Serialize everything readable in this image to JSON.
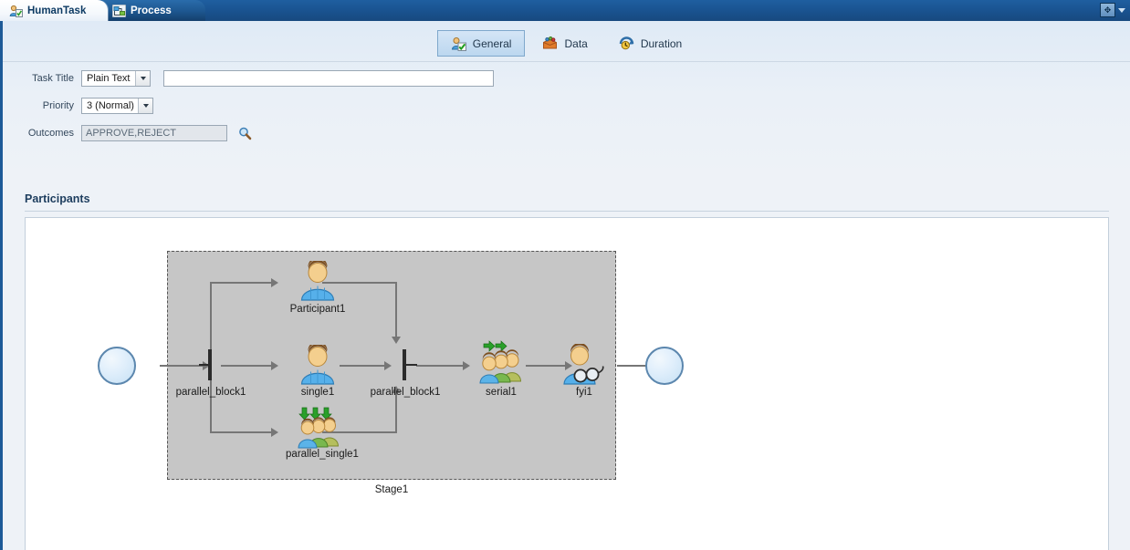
{
  "window": {
    "tabs": [
      {
        "label": "HumanTask",
        "icon": "human-task-icon",
        "active": true
      },
      {
        "label": "Process",
        "icon": "process-diagram-icon",
        "active": false
      }
    ],
    "buttons": {
      "restore_label": "✥",
      "menu_label": "▾"
    }
  },
  "subtabs": [
    {
      "label": "General",
      "icon": "general-icon",
      "selected": true
    },
    {
      "label": "Data",
      "icon": "data-icon",
      "selected": false
    },
    {
      "label": "Duration",
      "icon": "duration-icon",
      "selected": false
    }
  ],
  "form": {
    "task_title": {
      "label": "Task Title",
      "type_value": "Plain Text",
      "value": "",
      "placeholder": ""
    },
    "priority": {
      "label": "Priority",
      "value": "3 (Normal)"
    },
    "outcomes": {
      "label": "Outcomes",
      "value": "APPROVE,REJECT",
      "browse_icon": "magnifier-icon"
    }
  },
  "participants": {
    "section_title": "Participants",
    "stage_label": "Stage1",
    "nodes": [
      {
        "id": "start",
        "label": "",
        "icon": "start-event-icon"
      },
      {
        "id": "parallel_block_fork",
        "label": "parallel_block1",
        "icon": "gateway-icon"
      },
      {
        "id": "participant1",
        "label": "Participant1",
        "icon": "single-user-icon"
      },
      {
        "id": "single1",
        "label": "single1",
        "icon": "single-user-icon"
      },
      {
        "id": "parallel_single1",
        "label": "parallel_single1",
        "icon": "parallel-users-icon"
      },
      {
        "id": "parallel_block_join",
        "label": "parallel_block1",
        "icon": "gateway-icon"
      },
      {
        "id": "serial1",
        "label": "serial1",
        "icon": "serial-users-icon"
      },
      {
        "id": "fyi1",
        "label": "fyi1",
        "icon": "fyi-user-icon"
      },
      {
        "id": "end",
        "label": "",
        "icon": "end-event-icon"
      }
    ]
  },
  "colors": {
    "titlebar": "#1a5492",
    "accent": "#1d5a98",
    "stage_fill": "#c6c6c6",
    "connector": "#767676",
    "user_blue": "#4da0e0",
    "user_green": "#7fb25a",
    "arrow_green": "#2aa02a"
  }
}
